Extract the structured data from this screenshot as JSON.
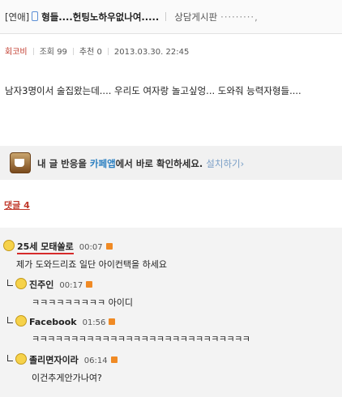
{
  "post": {
    "category": "[연애]",
    "title": "형들....헌팅노하우없나여.....",
    "board": "상담게시판",
    "board_dots": "·········,"
  },
  "meta": {
    "author": "회코비",
    "views": "조회 99",
    "likes": "추천 0",
    "datetime": "2013.03.30. 22:45"
  },
  "body": {
    "text": "남자3명이서 술집왔는데.... 우리도 여자랑 놀고싶엉... 도와줘 능력자형들...."
  },
  "promo": {
    "prefix": "내 글 반응을 ",
    "cafe_app": "카페앱",
    "suffix": "에서 바로 확인하세요.",
    "install": "설치하기",
    "arrow": "›"
  },
  "comments_header": {
    "label": "댓글 4"
  },
  "comments": [
    {
      "nick": "25세 모태쏠로",
      "time": "00:07",
      "text": "제가 도와드리죠 일단 아이컨택을 하세요"
    },
    {
      "nick": "진주인",
      "time": "00:17",
      "text": "ㅋㅋㅋㅋㅋㅋㅋㅋㅋ 아이디"
    },
    {
      "nick": "Facebook",
      "time": "01:56",
      "text": "ㅋㅋㅋㅋㅋㅋㅋㅋㅋㅋㅋㅋㅋㅋㅋㅋㅋㅋㅋㅋㅋㅋㅋㅋㅋㅋㅋㅋ"
    },
    {
      "nick": "졸리면자이라",
      "time": "06:14",
      "text": "이건추게안가나여?"
    }
  ]
}
